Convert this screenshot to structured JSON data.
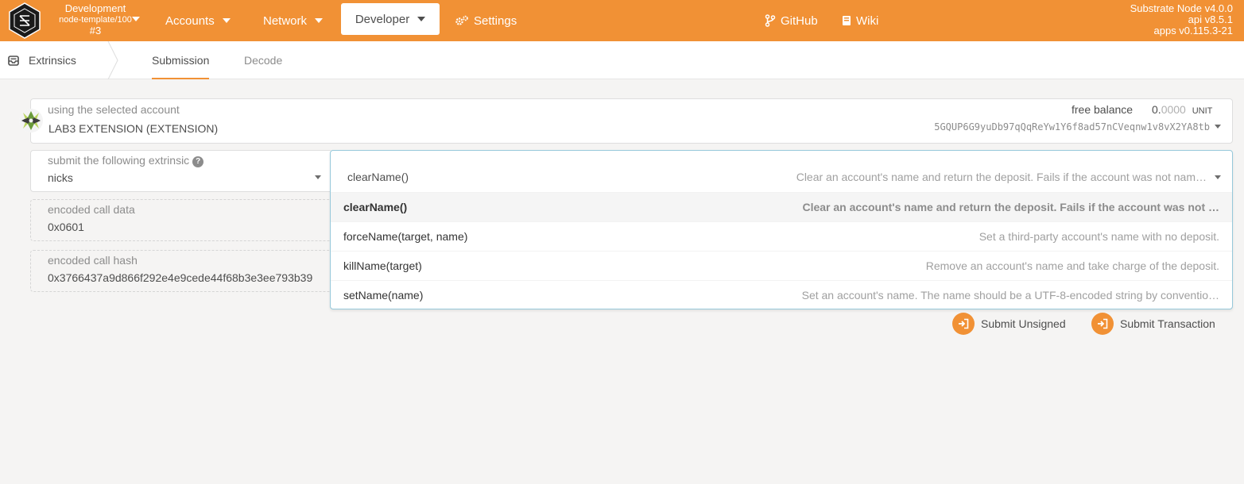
{
  "header": {
    "chain_name": "Development",
    "chain_runtime": "node-template/100",
    "chain_block": "#3",
    "nav": {
      "accounts": "Accounts",
      "network": "Network",
      "developer": "Developer",
      "settings": "Settings",
      "github": "GitHub",
      "wiki": "Wiki"
    },
    "version": {
      "node": "Substrate Node v4.0.0",
      "api": "api v8.5.1",
      "apps": "apps v0.115.3-21"
    },
    "accent": "#f19135"
  },
  "tabs": {
    "section": "Extrinsics",
    "items": [
      "Submission",
      "Decode"
    ],
    "active": "Submission"
  },
  "account": {
    "label": "using the selected account",
    "name": "LAB3 EXTENSION (EXTENSION)",
    "balance_label": "free balance",
    "balance_int": "0.",
    "balance_dec": "0000",
    "balance_unit": "UNIT",
    "address": "5GQUP6G9yuDb97qQqReYw1Y6f8ad57nCVeqnw1v8vX2YA8tb"
  },
  "extrinsic": {
    "label": "submit the following extrinsic",
    "help": "?",
    "pallet": "nicks",
    "selected_method": "clearName()",
    "selected_desc": "Clear an account's name and return the deposit. Fails if the account was not nam…",
    "options": [
      {
        "method": "clearName()",
        "desc": "Clear an account's name and return the deposit. Fails if the account was not …"
      },
      {
        "method": "forceName(target, name)",
        "desc": "Set a third-party account's name with no deposit."
      },
      {
        "method": "killName(target)",
        "desc": "Remove an account's name and take charge of the deposit."
      },
      {
        "method": "setName(name)",
        "desc": "Set an account's name. The name should be a UTF-8-encoded string by conventio…"
      }
    ]
  },
  "encoded": {
    "call_data_label": "encoded call data",
    "call_data": "0x0601",
    "call_hash_label": "encoded call hash",
    "call_hash": "0x3766437a9d866f292e4e9cede44f68b3e3ee793b39"
  },
  "actions": {
    "submit_unsigned": "Submit Unsigned",
    "submit_transaction": "Submit Transaction"
  }
}
